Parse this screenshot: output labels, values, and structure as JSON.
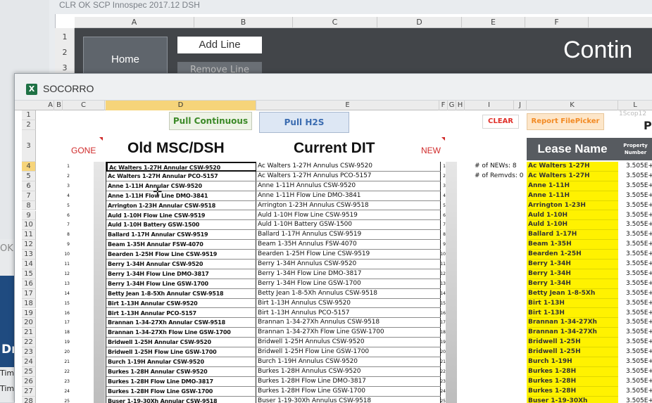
{
  "background_window": {
    "title": "CLR OK SCP Innospec 2017.12 DSH",
    "columns": [
      "A",
      "B",
      "C",
      "D",
      "E",
      "F"
    ],
    "rows": [
      "1",
      "2",
      "3"
    ],
    "home_button": "Home",
    "add_line_button": "Add Line",
    "remove_line_button": "Remove Line",
    "banner_text": "Contin",
    "left_panel": {
      "ok_label": "OK",
      "dr_label": "Dr",
      "tim1": "Tim",
      "tim2": "Tim"
    }
  },
  "window": {
    "title": "SOCORRO",
    "icon": "excel-icon"
  },
  "columns": [
    "A",
    "B",
    "C",
    "D",
    "E",
    "F",
    "G",
    "H",
    "I",
    "J",
    "K",
    "L"
  ],
  "selected_column": "D",
  "selected_row": "4",
  "toolbar": {
    "pull_continuous": "Pull Continuous",
    "pull_h2s": "Pull H2S",
    "clear": "CLEAR",
    "report_filepicker": "Report FilePicker",
    "corner_text": "1Scop12",
    "corner_letter": "P"
  },
  "headers": {
    "gone": "GONE",
    "old": "Old MSC/DSH",
    "current": "Current DIT",
    "new": "NEW",
    "lease_name": "Lease Name",
    "property_number": "Property Number"
  },
  "stats": {
    "news": "# of NEWs:  8",
    "removeds": "# of Remvds: 0"
  },
  "rows": [
    {
      "row": "4",
      "n": "1",
      "old": "Ac Walters 1-27H Annular CSW-9520",
      "current": "Ac Walters 1-27H Annulus CSW-9520",
      "lease": "Ac Walters 1-27H",
      "prop": "3.505E+"
    },
    {
      "row": "5",
      "n": "2",
      "old": "Ac Walters 1-27H Annular PCO-5157",
      "current": "Ac Walters 1-27H Annulus PCO-5157",
      "lease": "Ac Walters 1-27H",
      "prop": "3.505E+"
    },
    {
      "row": "6",
      "n": "3",
      "old": "Anne 1-11H Annular CSW-9520",
      "current": "Anne 1-11H Annulus CSW-9520",
      "lease": "Anne 1-11H",
      "prop": "3.505E+"
    },
    {
      "row": "7",
      "n": "4",
      "old": "Anne 1-11H Flow Line DMO-3841",
      "current": "Anne 1-11H Flow Line DMO-3841",
      "lease": "Anne 1-11H",
      "prop": "3.505E+"
    },
    {
      "row": "8",
      "n": "5",
      "old": "Arrington 1-23H Annular CSW-9518",
      "current": "Arrington 1-23H Annulus CSW-9518",
      "lease": "Arrington 1-23H",
      "prop": "3.505E+"
    },
    {
      "row": "9",
      "n": "6",
      "old": "Auld 1-10H Flow Line CSW-9519",
      "current": "Auld 1-10H Flow Line CSW-9519",
      "lease": "Auld 1-10H",
      "prop": "3.505E+"
    },
    {
      "row": "10",
      "n": "7",
      "old": "Auld 1-10H Battery GSW-1500",
      "current": "Auld 1-10H Battery GSW-1500",
      "lease": "Auld 1-10H",
      "prop": "3.505E+"
    },
    {
      "row": "11",
      "n": "8",
      "old": "Ballard 1-17H Annular CSW-9519",
      "current": "Ballard 1-17H Annulus CSW-9519",
      "lease": "Ballard 1-17H",
      "prop": "3.505E+"
    },
    {
      "row": "12",
      "n": "9",
      "old": "Beam 1-35H Annular FSW-4070",
      "current": "Beam 1-35H Annulus FSW-4070",
      "lease": "Beam 1-35H",
      "prop": "3.505E+"
    },
    {
      "row": "13",
      "n": "10",
      "old": "Bearden 1-25H Flow Line CSW-9519",
      "current": "Bearden 1-25H Flow Line CSW-9519",
      "lease": "Bearden 1-25H",
      "prop": "3.505E+"
    },
    {
      "row": "14",
      "n": "11",
      "old": "Berry 1-34H Annular CSW-9520",
      "current": "Berry 1-34H Annulus CSW-9520",
      "lease": "Berry 1-34H",
      "prop": "3.505E+"
    },
    {
      "row": "15",
      "n": "12",
      "old": "Berry 1-34H Flow Line DMO-3817",
      "current": "Berry 1-34H Flow Line DMO-3817",
      "lease": "Berry 1-34H",
      "prop": "3.505E+"
    },
    {
      "row": "16",
      "n": "13",
      "old": "Berry 1-34H Flow Line GSW-1700",
      "current": "Berry 1-34H Flow Line GSW-1700",
      "lease": "Berry 1-34H",
      "prop": "3.505E+"
    },
    {
      "row": "17",
      "n": "14",
      "old": "Betty Jean 1-8-5Xh Annular CSW-9518",
      "current": "Betty Jean 1-8-5Xh Annulus CSW-9518",
      "lease": "Betty Jean 1-8-5Xh",
      "prop": "3.505E+"
    },
    {
      "row": "18",
      "n": "15",
      "old": "Birt 1-13H Annular CSW-9520",
      "current": "Birt 1-13H Annulus CSW-9520",
      "lease": "Birt 1-13H",
      "prop": "3.505E+"
    },
    {
      "row": "19",
      "n": "16",
      "old": "Birt 1-13H Annular PCO-5157",
      "current": "Birt 1-13H Annulus PCO-5157",
      "lease": "Birt 1-13H",
      "prop": "3.505E+"
    },
    {
      "row": "20",
      "n": "17",
      "old": "Brannan 1-34-27Xh Annular CSW-9518",
      "current": "Brannan 1-34-27Xh Annulus CSW-9518",
      "lease": "Brannan 1-34-27Xh",
      "prop": "3.505E+"
    },
    {
      "row": "21",
      "n": "18",
      "old": "Brannan 1-34-27Xh Flow Line GSW-1700",
      "current": "Brannan 1-34-27Xh Flow Line GSW-1700",
      "lease": "Brannan 1-34-27Xh",
      "prop": "3.505E+"
    },
    {
      "row": "22",
      "n": "19",
      "old": "Bridwell 1-25H Annular CSW-9520",
      "current": "Bridwell 1-25H Annulus CSW-9520",
      "lease": "Bridwell 1-25H",
      "prop": "3.505E+"
    },
    {
      "row": "23",
      "n": "20",
      "old": "Bridwell 1-25H Flow Line GSW-1700",
      "current": "Bridwell 1-25H Flow Line GSW-1700",
      "lease": "Bridwell 1-25H",
      "prop": "3.505E+"
    },
    {
      "row": "24",
      "n": "21",
      "old": "Burch 1-19H Annular CSW-9520",
      "current": "Burch 1-19H Annulus CSW-9520",
      "lease": "Burch 1-19H",
      "prop": "3.505E+"
    },
    {
      "row": "25",
      "n": "22",
      "old": "Burkes 1-28H Annular CSW-9520",
      "current": "Burkes 1-28H Annulus CSW-9520",
      "lease": "Burkes 1-28H",
      "prop": "3.505E+"
    },
    {
      "row": "26",
      "n": "23",
      "old": "Burkes 1-28H Flow Line DMO-3817",
      "current": "Burkes 1-28H Flow Line DMO-3817",
      "lease": "Burkes 1-28H",
      "prop": "3.505E+"
    },
    {
      "row": "27",
      "n": "24",
      "old": "Burkes 1-28H Flow Line GSW-1700",
      "current": "Burkes 1-28H Flow Line GSW-1700",
      "lease": "Burkes 1-28H",
      "prop": "3.505E+"
    },
    {
      "row": "28",
      "n": "25",
      "old": "Buser 1-19-30Xh Annular CSW-9518",
      "current": "Buser 1-19-30Xh Annulus CSW-9518",
      "lease": "Buser 1-19-30Xh",
      "prop": "3.505E+"
    }
  ],
  "header_rows": [
    "1",
    "2",
    "3"
  ]
}
